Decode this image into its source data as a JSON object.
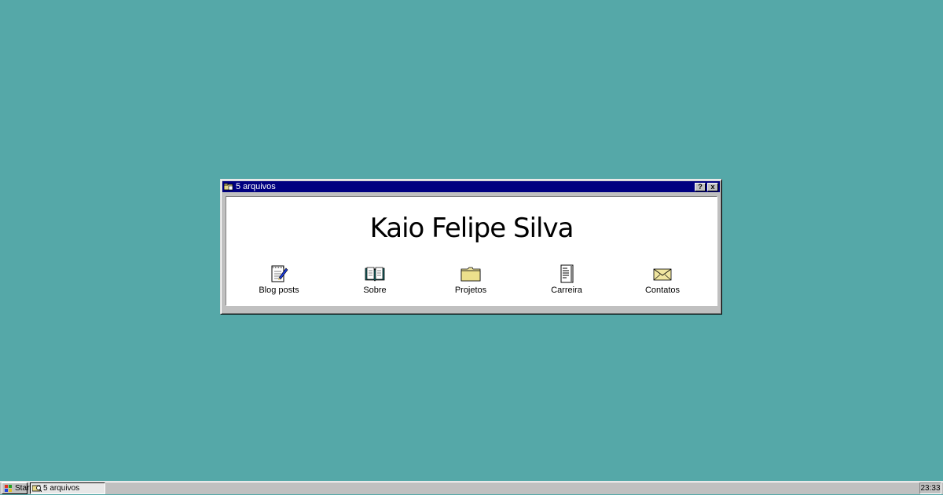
{
  "window": {
    "title": "5 arquivos",
    "help_label": "?",
    "close_label": "x",
    "heading": "Kaio Felipe Silva"
  },
  "items": [
    {
      "label": "Blog posts",
      "icon": "notepad-icon"
    },
    {
      "label": "Sobre",
      "icon": "book-icon"
    },
    {
      "label": "Projetos",
      "icon": "folder-icon"
    },
    {
      "label": "Carreira",
      "icon": "document-icon"
    },
    {
      "label": "Contatos",
      "icon": "envelope-icon"
    }
  ],
  "taskbar": {
    "start_label": "Start",
    "task_label": "5 arquivos",
    "clock": "23:33"
  },
  "colors": {
    "desktop": "#55a8a8",
    "titlebar": "#000080",
    "chrome": "#c0c0c0"
  }
}
